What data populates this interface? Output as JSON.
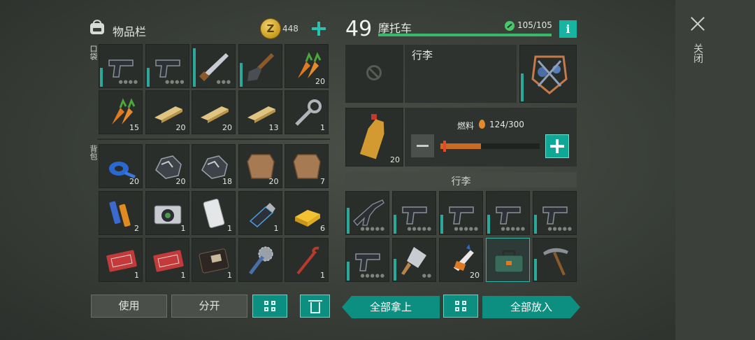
{
  "inventory": {
    "title": "物品栏",
    "coin_symbol": "Z",
    "coins": "448",
    "pocket_label": "口袋",
    "backpack_label": "背包",
    "pockets": [
      {
        "icon": "pistol-icon",
        "count": "",
        "durability": 0.45,
        "dots": "●●●●"
      },
      {
        "icon": "pistol-icon",
        "count": "",
        "durability": 0.45,
        "dots": "●●●●"
      },
      {
        "icon": "machete-icon",
        "count": "",
        "durability": 0.9,
        "dots": "●●●"
      },
      {
        "icon": "shovel-icon",
        "count": "",
        "durability": 0.55,
        "dots": ""
      },
      {
        "icon": "carrot-icon",
        "count": "20",
        "durability": 0,
        "dots": ""
      },
      {
        "icon": "carrot-icon",
        "count": "15",
        "durability": 0,
        "dots": ""
      },
      {
        "icon": "plank-icon",
        "count": "20",
        "durability": 0,
        "dots": ""
      },
      {
        "icon": "plank-icon",
        "count": "20",
        "durability": 0,
        "dots": ""
      },
      {
        "icon": "plank-icon",
        "count": "13",
        "durability": 0,
        "dots": ""
      },
      {
        "icon": "wrench-icon",
        "count": "1",
        "durability": 0,
        "dots": ""
      }
    ],
    "backpack": [
      {
        "icon": "duct-tape-icon",
        "count": "20"
      },
      {
        "icon": "ore-icon",
        "count": "20"
      },
      {
        "icon": "ore-icon",
        "count": "18"
      },
      {
        "icon": "hide-icon",
        "count": "20"
      },
      {
        "icon": "hide-icon",
        "count": "7"
      },
      {
        "icon": "batteries-icon",
        "count": "2"
      },
      {
        "icon": "camera-icon",
        "count": "1"
      },
      {
        "icon": "smartphone-icon",
        "count": "1"
      },
      {
        "icon": "usb-drive-icon",
        "count": "1"
      },
      {
        "icon": "gold-bar-icon",
        "count": "6"
      },
      {
        "icon": "coupon-icon",
        "count": "1"
      },
      {
        "icon": "coupon-icon",
        "count": "1"
      },
      {
        "icon": "wallet-icon",
        "count": "1"
      },
      {
        "icon": "saw-mace-icon",
        "count": ""
      },
      {
        "icon": "crowbar-icon",
        "count": "1"
      }
    ]
  },
  "vehicle": {
    "level": "49",
    "name": "摩托车",
    "hp": "105/105",
    "info_label": "i",
    "trunk_title": "行李",
    "fuel_label": "燃料",
    "fuel_value": "124/300",
    "fuel_fraction": 0.41,
    "fuel_item_count": "20",
    "trunk_section_label": "行李",
    "trunk_items": [
      {
        "icon": "assault-rifle-icon",
        "count": "",
        "durability": 0.6,
        "dots": "●●●●●"
      },
      {
        "icon": "pistol-icon",
        "count": "",
        "durability": 0.45,
        "dots": "●●●●●"
      },
      {
        "icon": "pistol-icon",
        "count": "",
        "durability": 0.45,
        "dots": "●●●●●"
      },
      {
        "icon": "pistol-icon",
        "count": "",
        "durability": 0.45,
        "dots": "●●●●●"
      },
      {
        "icon": "pistol-icon",
        "count": "",
        "durability": 0.45,
        "dots": "●●●●●"
      },
      {
        "icon": "pistol-icon",
        "count": "",
        "durability": 0.45,
        "dots": "●●●●●"
      },
      {
        "icon": "cleaver-icon",
        "count": "",
        "durability": 0.5,
        "dots": "●●"
      },
      {
        "icon": "glue-icon",
        "count": "20",
        "durability": 0,
        "dots": ""
      },
      {
        "icon": "toolbox-icon",
        "count": "",
        "durability": 0,
        "dots": "",
        "selected": true
      },
      {
        "icon": "pickaxe-icon",
        "count": "",
        "durability": 0.5,
        "dots": ""
      }
    ]
  },
  "buttons": {
    "use": "使用",
    "split": "分开",
    "take_all": "全部拿上",
    "put_all": "全部放入"
  },
  "close_label": "关闭"
}
